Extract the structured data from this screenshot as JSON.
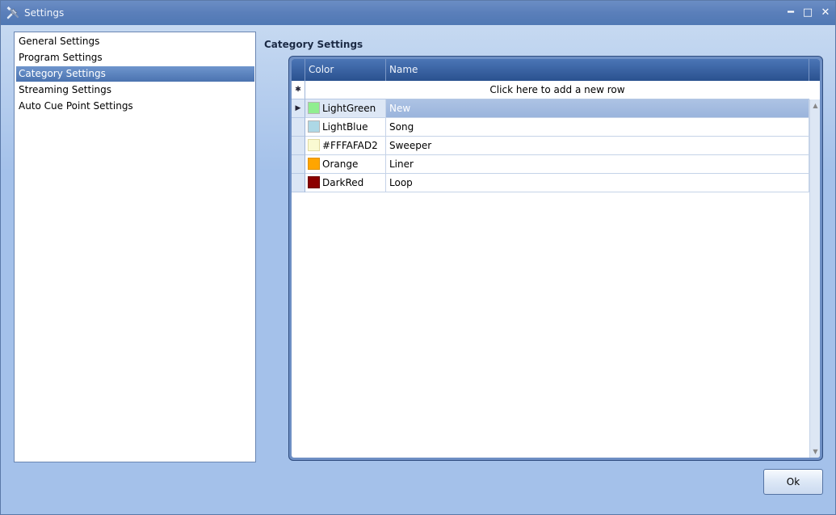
{
  "window": {
    "title": "Settings",
    "app_icon": "tools-icon",
    "controls": {
      "minimize": "━",
      "maximize": "□",
      "close": "✕"
    }
  },
  "nav": {
    "items": [
      {
        "label": "General Settings",
        "selected": false
      },
      {
        "label": "Program Settings",
        "selected": false
      },
      {
        "label": "Category Settings",
        "selected": true
      },
      {
        "label": "Streaming Settings",
        "selected": false
      },
      {
        "label": "Auto Cue Point Settings",
        "selected": false
      }
    ]
  },
  "main": {
    "section_title": "Category Settings",
    "grid": {
      "columns": [
        "Color",
        "Name"
      ],
      "new_row_text": "Click here to add a new row",
      "new_row_marker": "✱",
      "current_row_marker": "▶",
      "rows": [
        {
          "color_label": "LightGreen",
          "swatch": "#90ee90",
          "name": "New"
        },
        {
          "color_label": "LightBlue",
          "swatch": "#add8e6",
          "name": "Song"
        },
        {
          "color_label": "#FFFAFAD2",
          "swatch": "#fafad2",
          "name": "Sweeper"
        },
        {
          "color_label": "Orange",
          "swatch": "#ffa500",
          "name": "Liner"
        },
        {
          "color_label": "DarkRed",
          "swatch": "#8b0000",
          "name": "Loop"
        }
      ]
    }
  },
  "footer": {
    "ok_label": "Ok"
  }
}
